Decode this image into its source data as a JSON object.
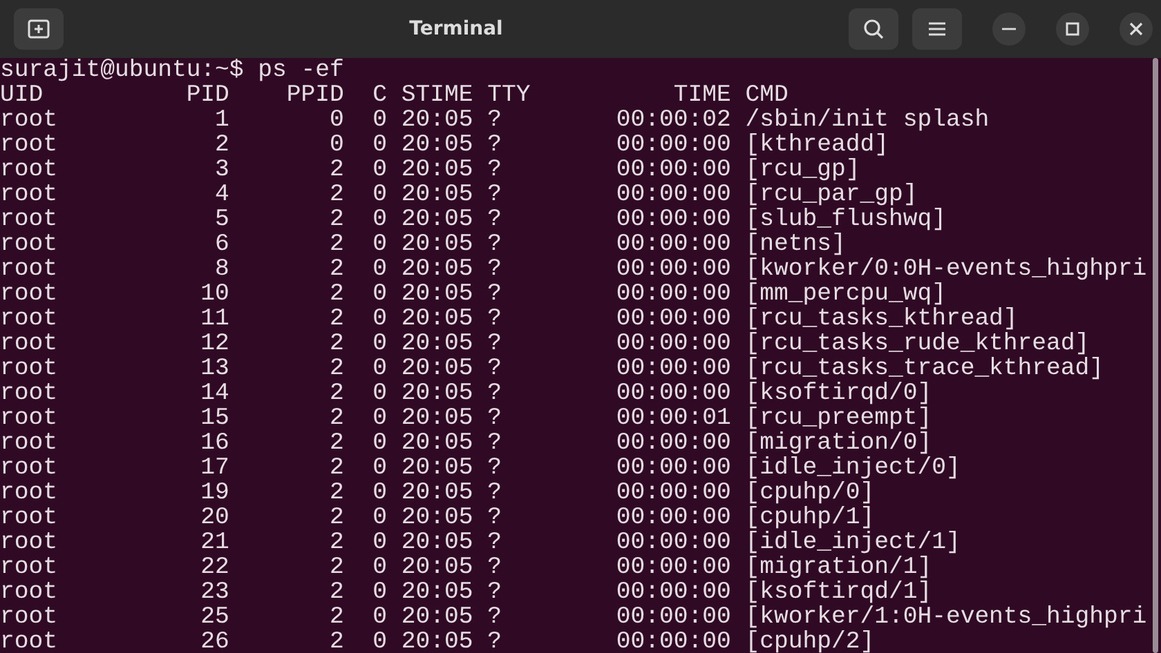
{
  "window": {
    "title": "Terminal"
  },
  "prompt": "surajit@ubuntu:~$ ps -ef",
  "output": [
    "UID          PID    PPID  C STIME TTY          TIME CMD",
    "root           1       0  0 20:05 ?        00:00:02 /sbin/init splash",
    "root           2       0  0 20:05 ?        00:00:00 [kthreadd]",
    "root           3       2  0 20:05 ?        00:00:00 [rcu_gp]",
    "root           4       2  0 20:05 ?        00:00:00 [rcu_par_gp]",
    "root           5       2  0 20:05 ?        00:00:00 [slub_flushwq]",
    "root           6       2  0 20:05 ?        00:00:00 [netns]",
    "root           8       2  0 20:05 ?        00:00:00 [kworker/0:0H-events_highpri",
    "root          10       2  0 20:05 ?        00:00:00 [mm_percpu_wq]",
    "root          11       2  0 20:05 ?        00:00:00 [rcu_tasks_kthread]",
    "root          12       2  0 20:05 ?        00:00:00 [rcu_tasks_rude_kthread]",
    "root          13       2  0 20:05 ?        00:00:00 [rcu_tasks_trace_kthread]",
    "root          14       2  0 20:05 ?        00:00:00 [ksoftirqd/0]",
    "root          15       2  0 20:05 ?        00:00:01 [rcu_preempt]",
    "root          16       2  0 20:05 ?        00:00:00 [migration/0]",
    "root          17       2  0 20:05 ?        00:00:00 [idle_inject/0]",
    "root          19       2  0 20:05 ?        00:00:00 [cpuhp/0]",
    "root          20       2  0 20:05 ?        00:00:00 [cpuhp/1]",
    "root          21       2  0 20:05 ?        00:00:00 [idle_inject/1]",
    "root          22       2  0 20:05 ?        00:00:00 [migration/1]",
    "root          23       2  0 20:05 ?        00:00:00 [ksoftirqd/1]",
    "root          25       2  0 20:05 ?        00:00:00 [kworker/1:0H-events_highpri",
    "root          26       2  0 20:05 ?        00:00:00 [cpuhp/2]"
  ]
}
